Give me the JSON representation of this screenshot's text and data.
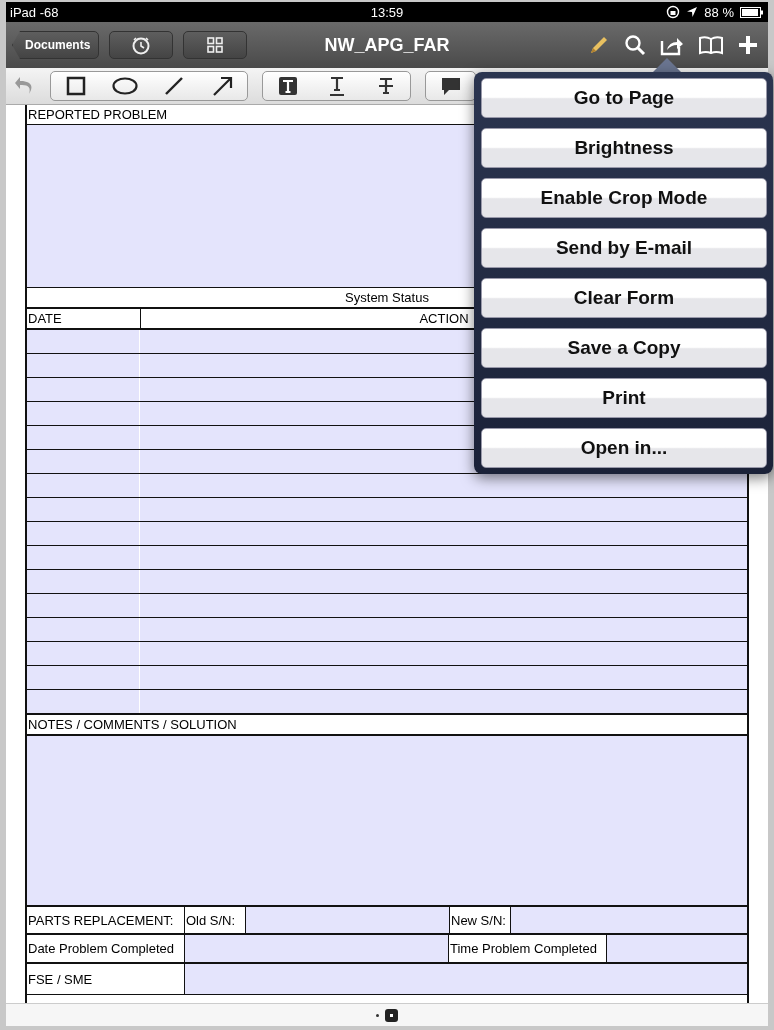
{
  "status_bar": {
    "carrier": "iPad -68",
    "time": "13:59",
    "battery": "88 %"
  },
  "nav_bar": {
    "back": "Documents",
    "title": "NW_APG_FAR"
  },
  "menu": [
    {
      "label": "Go to Page"
    },
    {
      "label": "Brightness"
    },
    {
      "label": "Enable Crop Mode"
    },
    {
      "label": "Send by E-mail"
    },
    {
      "label": "Clear Form"
    },
    {
      "label": "Save a Copy"
    },
    {
      "label": "Print"
    },
    {
      "label": "Open in..."
    }
  ],
  "form": {
    "reported_problem": "REPORTED PROBLEM",
    "system_status": "System Status",
    "date_header": "DATE",
    "action_header": "ACTION",
    "notes": "NOTES / COMMENTS / SOLUTION",
    "parts_replacement": "PARTS REPLACEMENT:",
    "old_sn": "Old S/N:",
    "new_sn": "New S/N:",
    "date_completed": "Date Problem Completed",
    "time_completed": "Time Problem Completed",
    "fse_sme": "FSE / SME"
  }
}
